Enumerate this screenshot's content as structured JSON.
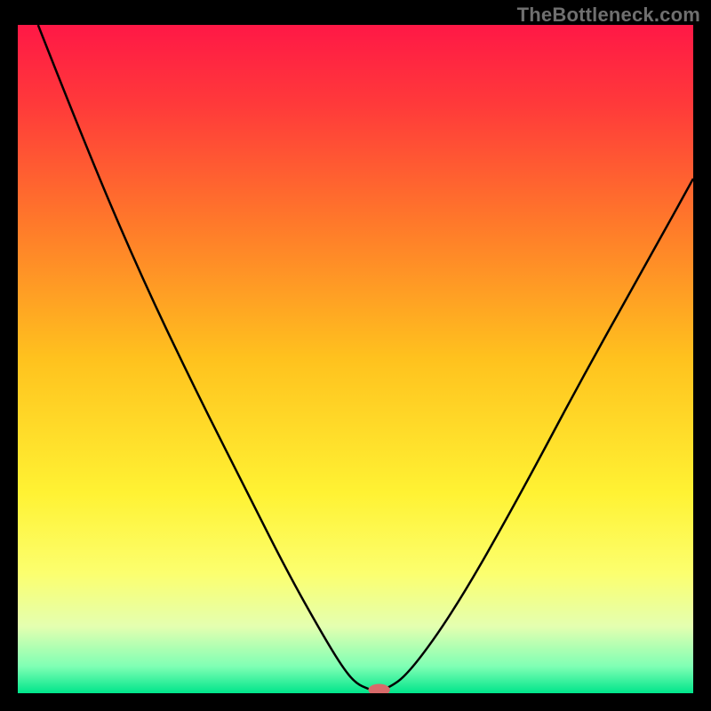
{
  "watermark": "TheBottleneck.com",
  "chart_data": {
    "type": "line",
    "title": "",
    "xlabel": "",
    "ylabel": "",
    "xlim": [
      0.0,
      1.0
    ],
    "ylim": [
      0.0,
      1.0
    ],
    "background_gradient": {
      "stops": [
        {
          "offset": 0.0,
          "color": "#ff1846"
        },
        {
          "offset": 0.12,
          "color": "#ff3a3a"
        },
        {
          "offset": 0.3,
          "color": "#ff7a2a"
        },
        {
          "offset": 0.5,
          "color": "#ffc21e"
        },
        {
          "offset": 0.7,
          "color": "#fff233"
        },
        {
          "offset": 0.82,
          "color": "#fcff6e"
        },
        {
          "offset": 0.9,
          "color": "#e4ffb0"
        },
        {
          "offset": 0.96,
          "color": "#7fffb4"
        },
        {
          "offset": 1.0,
          "color": "#00e58b"
        }
      ]
    },
    "series": [
      {
        "name": "bottleneck-curve",
        "color": "#000000",
        "x": [
          0.03,
          0.1,
          0.18,
          0.26,
          0.34,
          0.4,
          0.45,
          0.48,
          0.5,
          0.52,
          0.525,
          0.545,
          0.58,
          0.65,
          0.74,
          0.84,
          0.94,
          1.0
        ],
        "y": [
          1.0,
          0.82,
          0.63,
          0.46,
          0.3,
          0.18,
          0.09,
          0.04,
          0.015,
          0.006,
          0.005,
          0.005,
          0.03,
          0.13,
          0.29,
          0.48,
          0.66,
          0.77
        ]
      }
    ],
    "marker": {
      "name": "optimal-point",
      "x": 0.535,
      "y": 0.005,
      "rx": 0.016,
      "ry": 0.009,
      "color": "#d86a6a"
    }
  }
}
